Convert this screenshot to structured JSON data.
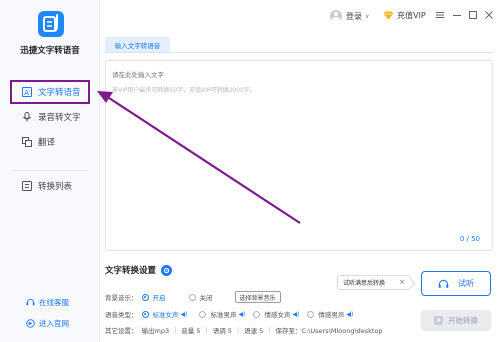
{
  "app": {
    "name": "迅捷文字转语音"
  },
  "sidebar": {
    "items": [
      {
        "label": "文字转语音",
        "icon": "text-to-speech-icon",
        "active": true
      },
      {
        "label": "录音转文字",
        "icon": "microphone-icon",
        "active": false
      },
      {
        "label": "翻译",
        "icon": "translate-icon",
        "active": false
      },
      {
        "label": "转换列表",
        "icon": "list-icon",
        "active": false
      }
    ],
    "footer": [
      {
        "label": "在线客服",
        "icon": "customer-service-icon"
      },
      {
        "label": "进入官网",
        "icon": "website-icon"
      }
    ]
  },
  "titlebar": {
    "login_label": "登录",
    "vip_label": "充值VIP"
  },
  "tabs": [
    {
      "label": "输入文字转语音",
      "active": true
    }
  ],
  "editor": {
    "placeholder_main": "请在此处输入文字",
    "placeholder_hint": "非VIP用户最多可转换50字，充值VIP可转换2000字。",
    "counter": "0 / 50"
  },
  "settings": {
    "title": "文字转换设置",
    "bgm": {
      "label": "背景音乐：",
      "options": [
        "开启",
        "关闭"
      ],
      "selected": "开启",
      "choose_button": "选择背景音乐"
    },
    "voice": {
      "label": "语音类型：",
      "options": [
        "标准女声",
        "标准男声",
        "情感女声",
        "情感男声"
      ],
      "selected": "标准女声"
    },
    "other": {
      "label": "其它设置：",
      "format": "输出mp3",
      "volume": "音量 5",
      "pitch": "语调 5",
      "speed": "语速 5",
      "save_to": "保存至：C:\\Users\\Mloong\\desktop"
    }
  },
  "tooltip": {
    "text": "试听满意后转换"
  },
  "buttons": {
    "listen": "试听",
    "convert": "开始转换"
  },
  "colors": {
    "accent": "#1e78ff",
    "annotation": "#7b1c8c"
  }
}
